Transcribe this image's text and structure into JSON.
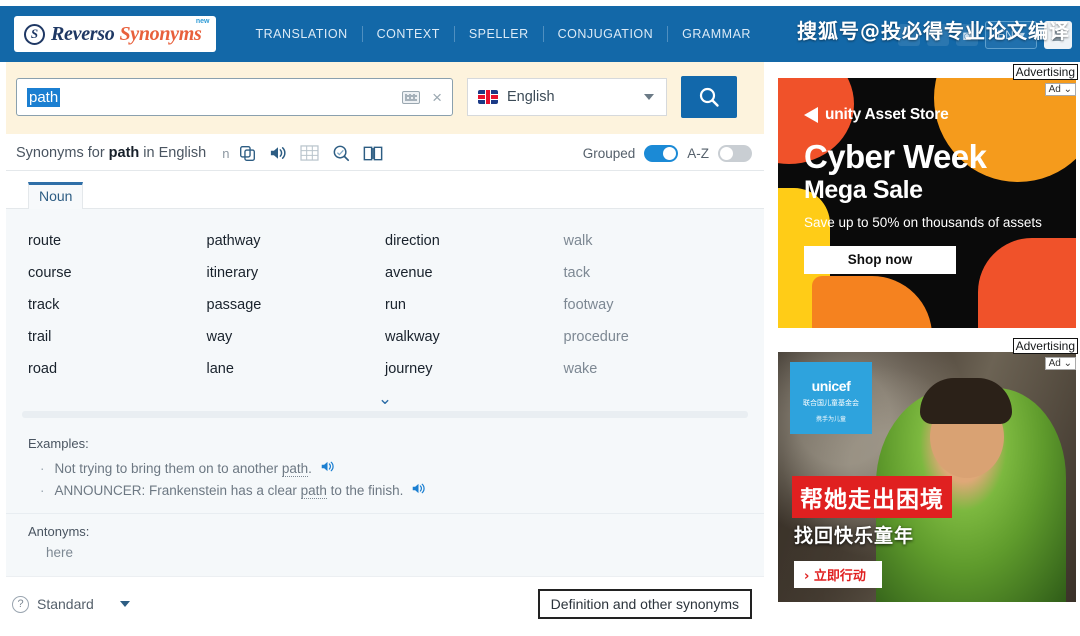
{
  "nav": {
    "logo": {
      "mark": "S",
      "brand": "Reverso",
      "product": "Synonyms",
      "badge": "new"
    },
    "links": [
      "TRANSLATION",
      "CONTEXT",
      "SPELLER",
      "CONJUGATION",
      "GRAMMAR"
    ],
    "social": [
      "facebook-icon",
      "twitter-icon",
      "instagram-icon"
    ],
    "lang_button": "EN",
    "watermark": "搜狐号@投必得专业论文编译",
    "bg_color": "#1368a8"
  },
  "search": {
    "value": "path",
    "placeholder": "",
    "keyboard_icon": "keyboard-icon",
    "clear_icon": "×",
    "language": "English",
    "flag": "uk-flag",
    "submit_icon": "search-icon",
    "band_color": "#fdf3dd"
  },
  "results": {
    "title_prefix": "Synonyms for ",
    "title_word": "path",
    "title_suffix": " in English",
    "pos_abbr": "n",
    "icons": [
      "copy-icon",
      "speaker-icon",
      "grid-icon",
      "search-in-page-icon",
      "dictionary-icon"
    ],
    "toggle_grouped_label": "Grouped",
    "toggle_grouped_on": true,
    "toggle_az_label": "A-Z",
    "toggle_az_on": false,
    "accent_color": "#1b8ad6"
  },
  "pos_tab": {
    "label": "Noun",
    "active": true
  },
  "synonyms": {
    "col1": [
      "route",
      "course",
      "track",
      "trail",
      "road"
    ],
    "col2": [
      "pathway",
      "itinerary",
      "passage",
      "way",
      "lane"
    ],
    "col3": [
      "direction",
      "avenue",
      "run",
      "walkway",
      "journey"
    ],
    "col4": [
      "walk",
      "tack",
      "footway",
      "procedure",
      "wake"
    ],
    "expand_icon": "chevron-down-icon"
  },
  "examples": {
    "label": "Examples:",
    "items": [
      {
        "before": "Not trying to bring them on to another ",
        "word": "path",
        "after": "."
      },
      {
        "before": "ANNOUNCER: Frankenstein has a clear ",
        "word": "path",
        "after": " to the finish."
      }
    ]
  },
  "antonyms": {
    "label": "Antonyms:",
    "words": [
      "here"
    ]
  },
  "bottom": {
    "help_icon": "?",
    "mode": "Standard",
    "definition_button": "Definition and other synonyms"
  },
  "ads": [
    {
      "label": "Advertising",
      "choice": "Ad",
      "brand": "unity Asset Store",
      "headline": "Cyber Week",
      "subhead": "Mega Sale",
      "body": "Save up to 50% on thousands of assets",
      "cta": "Shop now"
    },
    {
      "label": "Advertising",
      "choice": "Ad",
      "logo_line1": "unicef",
      "logo_line2": "联合国儿童基金会",
      "logo_line3": "携手为儿童",
      "headline": "帮她走出困境",
      "subhead": "找回快乐童年",
      "cta": "› 立即行动"
    }
  ]
}
